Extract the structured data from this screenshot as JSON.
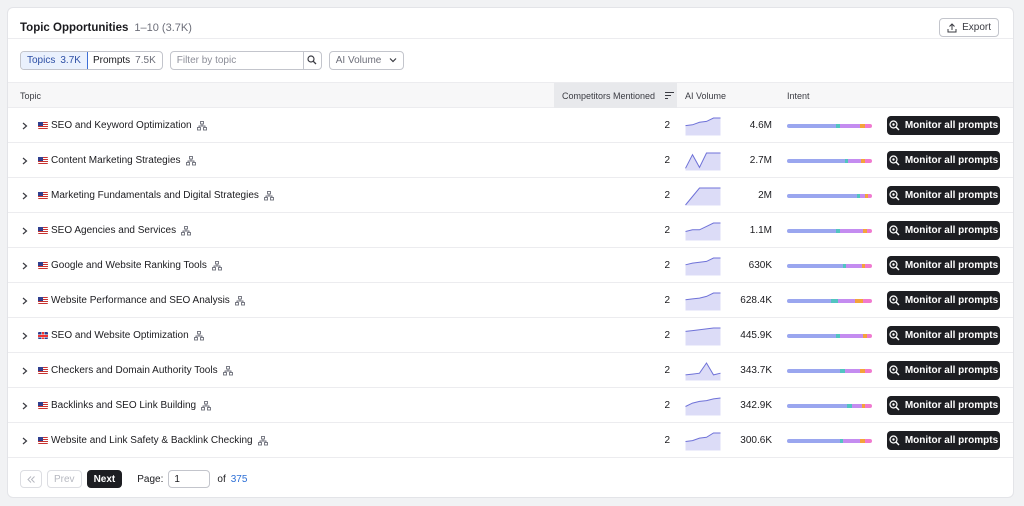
{
  "header": {
    "title": "Topic Opportunities",
    "range": "1–10 (3.7K)",
    "export_label": "Export"
  },
  "filters": {
    "tabs": [
      {
        "label": "Topics",
        "count": "3.7K"
      },
      {
        "label": "Prompts",
        "count": "7.5K"
      }
    ],
    "search_placeholder": "Filter by topic",
    "volume_dropdown": "AI Volume"
  },
  "table": {
    "columns": {
      "topic": "Topic",
      "competitors": "Competitors Mentioned",
      "volume": "AI Volume",
      "intent": "Intent"
    },
    "monitor_label": "Monitor all prompts",
    "intent_colors": [
      "#9aa6ef",
      "#52c4c1",
      "#c48cf0",
      "#f4a33a",
      "#f07ad0"
    ],
    "rows": [
      {
        "topic": "SEO and Keyword Optimization",
        "flag": "us-flag",
        "competitors": "2",
        "volume": "4.6M",
        "spark": [
          0.55,
          0.6,
          0.75,
          0.8,
          1.0,
          1.0
        ],
        "intent": [
          0.58,
          0.04,
          0.24,
          0.06,
          0.08
        ]
      },
      {
        "topic": "Content Marketing Strategies",
        "flag": "us-flag",
        "competitors": "2",
        "volume": "2.7M",
        "spark": [
          0.1,
          0.9,
          0.15,
          1.0,
          1.0,
          1.0
        ],
        "intent": [
          0.68,
          0.04,
          0.15,
          0.05,
          0.08
        ]
      },
      {
        "topic": "Marketing Fundamentals and Digital Strategies",
        "flag": "us-flag",
        "competitors": "2",
        "volume": "2M",
        "spark": [
          0.0,
          0.5,
          1.0,
          1.0,
          1.0,
          1.0
        ],
        "intent": [
          0.82,
          0.04,
          0.06,
          0.03,
          0.05
        ]
      },
      {
        "topic": "SEO Agencies and Services",
        "flag": "us-flag",
        "competitors": "2",
        "volume": "1.1M",
        "spark": [
          0.5,
          0.6,
          0.6,
          0.8,
          1.0,
          1.0
        ],
        "intent": [
          0.58,
          0.04,
          0.28,
          0.04,
          0.06
        ]
      },
      {
        "topic": "Google and Website Ranking Tools",
        "flag": "us-flag",
        "competitors": "2",
        "volume": "630K",
        "spark": [
          0.6,
          0.7,
          0.75,
          0.8,
          1.0,
          1.0
        ],
        "intent": [
          0.66,
          0.04,
          0.18,
          0.04,
          0.08
        ]
      },
      {
        "topic": "Website Performance and SEO Analysis",
        "flag": "us-flag",
        "competitors": "2",
        "volume": "628.4K",
        "spark": [
          0.6,
          0.65,
          0.7,
          0.8,
          1.0,
          1.0
        ],
        "intent": [
          0.52,
          0.08,
          0.2,
          0.1,
          0.1
        ]
      },
      {
        "topic": "SEO and Website Optimization",
        "flag": "gb-flag",
        "competitors": "2",
        "volume": "445.9K",
        "spark": [
          0.8,
          0.85,
          0.9,
          0.95,
          1.0,
          1.0
        ],
        "intent": [
          0.58,
          0.04,
          0.28,
          0.04,
          0.06
        ]
      },
      {
        "topic": "Checkers and Domain Authority Tools",
        "flag": "us-flag",
        "competitors": "2",
        "volume": "343.7K",
        "spark": [
          0.3,
          0.35,
          0.4,
          1.0,
          0.3,
          0.4
        ],
        "intent": [
          0.62,
          0.06,
          0.18,
          0.06,
          0.08
        ]
      },
      {
        "topic": "Backlinks and SEO Link Building",
        "flag": "us-flag",
        "competitors": "2",
        "volume": "342.9K",
        "spark": [
          0.5,
          0.7,
          0.8,
          0.85,
          0.95,
          1.0
        ],
        "intent": [
          0.7,
          0.06,
          0.12,
          0.04,
          0.08
        ]
      },
      {
        "topic": "Website and Link Safety & Backlink Checking",
        "flag": "us-flag",
        "competitors": "2",
        "volume": "300.6K",
        "spark": [
          0.5,
          0.55,
          0.7,
          0.75,
          1.0,
          1.0
        ],
        "intent": [
          0.62,
          0.04,
          0.2,
          0.06,
          0.08
        ]
      }
    ]
  },
  "pagination": {
    "prev_label": "Prev",
    "next_label": "Next",
    "page_label": "Page:",
    "page_value": "1",
    "of_label": "of",
    "total_pages": "375"
  }
}
